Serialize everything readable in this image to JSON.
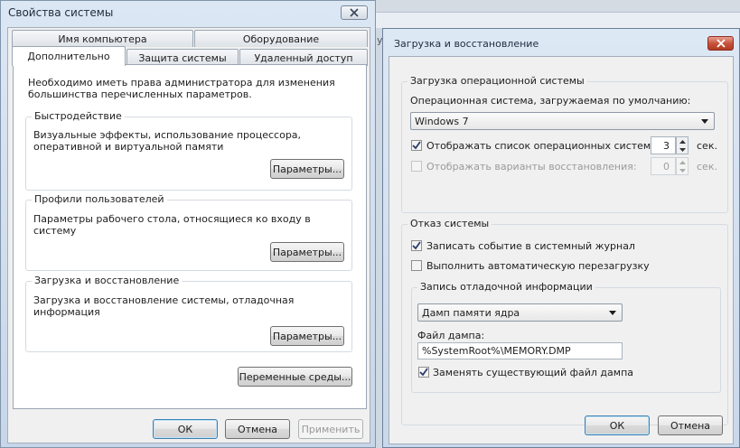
{
  "left_window": {
    "title": "Свойства системы",
    "tabs_row1": [
      "Имя компьютера",
      "Оборудование"
    ],
    "tabs_row2": [
      "Дополнительно",
      "Защита системы",
      "Удаленный доступ"
    ],
    "intro": "Необходимо иметь права администратора для изменения большинства перечисленных параметров.",
    "performance": {
      "title": "Быстродействие",
      "text": "Визуальные эффекты, использование процессора, оперативной и виртуальной памяти",
      "button": "Параметры..."
    },
    "profiles": {
      "title": "Профили пользователей",
      "text": "Параметры рабочего стола, относящиеся ко входу в систему",
      "button": "Параметры..."
    },
    "startup": {
      "title": "Загрузка и восстановление",
      "text": "Загрузка и восстановление системы, отладочная информация",
      "button": "Параметры..."
    },
    "env_button": "Переменные среды...",
    "ok": "ОК",
    "cancel": "Отмена",
    "apply": "Применить"
  },
  "right_window": {
    "title": "Загрузка и восстановление",
    "os_group": {
      "title": "Загрузка операционной системы",
      "default_os_label": "Операционная система, загружаемая по умолчанию:",
      "default_os_value": "Windows 7",
      "show_list_label": "Отображать список операционных систем:",
      "show_list_checked": true,
      "show_list_value": "3",
      "show_recovery_label": "Отображать варианты восстановления:",
      "show_recovery_checked": false,
      "show_recovery_value": "0",
      "sec": "сек."
    },
    "failure_group": {
      "title": "Отказ системы",
      "log_event_label": "Записать событие в системный журнал",
      "log_event_checked": true,
      "auto_restart_label": "Выполнить автоматическую перезагрузку",
      "auto_restart_checked": false,
      "debug_group": {
        "title": "Запись отладочной информации",
        "dump_type": "Дамп памяти ядра",
        "dump_file_label": "Файл дампа:",
        "dump_file_value": "%SystemRoot%\\MEMORY.DMP",
        "overwrite_label": "Заменять существующий файл дампа",
        "overwrite_checked": true
      }
    },
    "ok": "ОК",
    "cancel": "Отмена"
  },
  "background": {
    "partial_text": "у"
  }
}
